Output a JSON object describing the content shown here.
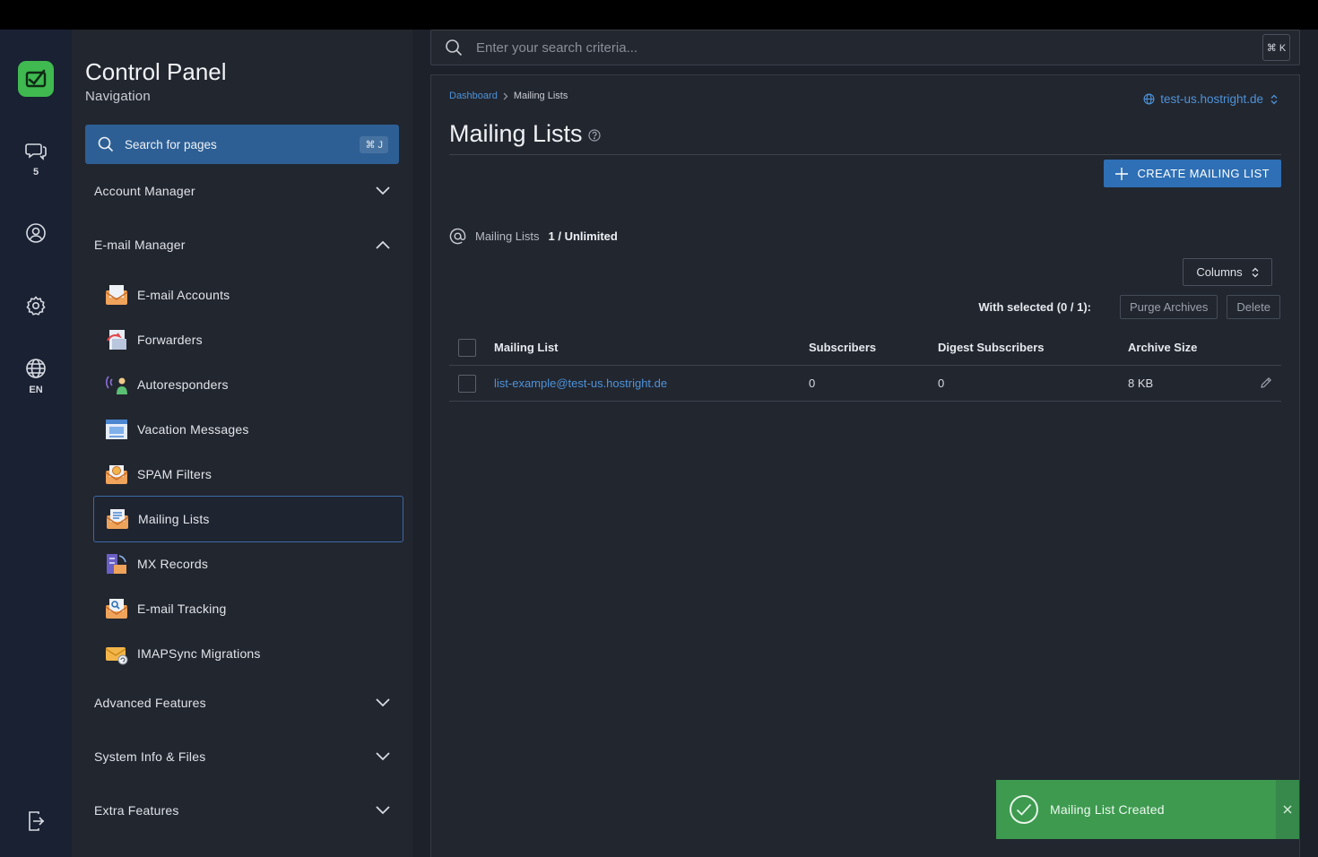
{
  "rail": {
    "chat_count": "5",
    "language": "EN"
  },
  "nav": {
    "title": "Control Panel",
    "subtitle": "Navigation",
    "search_label": "Search for pages",
    "search_shortcut": "⌘ J",
    "sections": {
      "account_manager": "Account Manager",
      "email_manager": "E-mail Manager",
      "advanced_features": "Advanced Features",
      "system_info": "System Info & Files",
      "extra_features": "Extra Features"
    },
    "items": [
      {
        "label": "E-mail Accounts",
        "icon": "email-accounts-icon"
      },
      {
        "label": "Forwarders",
        "icon": "forwarders-icon"
      },
      {
        "label": "Autoresponders",
        "icon": "autoresponders-icon"
      },
      {
        "label": "Vacation Messages",
        "icon": "vacation-messages-icon"
      },
      {
        "label": "SPAM Filters",
        "icon": "spam-filters-icon"
      },
      {
        "label": "Mailing Lists",
        "icon": "mailing-lists-icon",
        "active": true
      },
      {
        "label": "MX Records",
        "icon": "mx-records-icon"
      },
      {
        "label": "E-mail Tracking",
        "icon": "email-tracking-icon"
      },
      {
        "label": "IMAPSync Migrations",
        "icon": "imapsync-icon"
      }
    ]
  },
  "search": {
    "placeholder": "Enter your search criteria...",
    "shortcut": "⌘ K"
  },
  "breadcrumb": {
    "root": "Dashboard",
    "current": "Mailing Lists"
  },
  "domain_selector": "test-us.hostright.de",
  "page": {
    "title": "Mailing Lists",
    "create_button": "CREATE MAILING LIST",
    "quota_label": "Mailing Lists",
    "quota_value": "1 / Unlimited",
    "columns_button": "Columns",
    "with_selected": "With selected (0 / 1):",
    "purge_button": "Purge Archives",
    "delete_button": "Delete"
  },
  "table": {
    "headers": [
      "Mailing List",
      "Subscribers",
      "Digest Subscribers",
      "Archive Size"
    ],
    "rows": [
      {
        "list": "list-example@test-us.hostright.de",
        "subscribers": "0",
        "digest": "0",
        "size": "8 KB"
      }
    ]
  },
  "toast": {
    "message": "Mailing List Created"
  },
  "colors": {
    "accent": "#2e6fb5",
    "link": "#4e93d9",
    "success": "#3d9a4f",
    "brand": "#3fb950"
  }
}
